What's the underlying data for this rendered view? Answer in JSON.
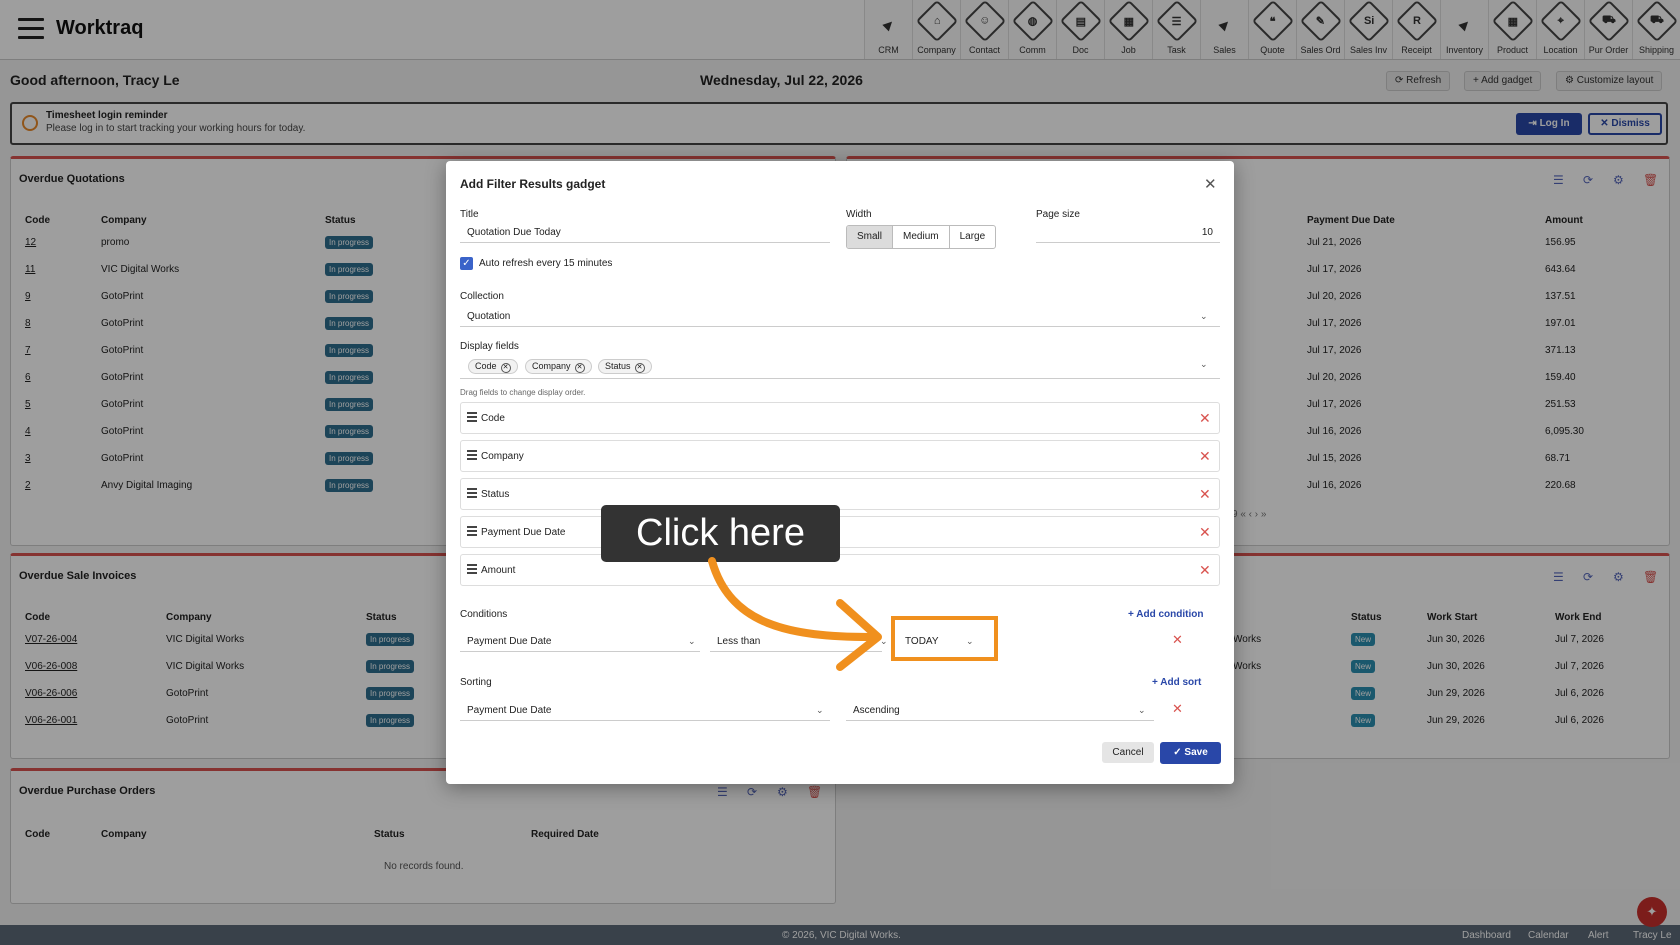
{
  "app": {
    "title": "Worktraq"
  },
  "modules": [
    {
      "label": "CRM",
      "icon": "chevron-right-icon",
      "glyph": "▶",
      "divider": true
    },
    {
      "label": "Company",
      "icon": "company-icon",
      "glyph": "⌂"
    },
    {
      "label": "Contact",
      "icon": "contact-icon",
      "glyph": "☺"
    },
    {
      "label": "Comm",
      "icon": "comm-icon",
      "glyph": "◍"
    },
    {
      "label": "Doc",
      "icon": "doc-icon",
      "glyph": "▤"
    },
    {
      "label": "Job",
      "icon": "job-icon",
      "glyph": "▦"
    },
    {
      "label": "Task",
      "icon": "task-icon",
      "glyph": "☰"
    },
    {
      "label": "Sales",
      "icon": "chevron-right-icon",
      "glyph": "▶",
      "divider": true
    },
    {
      "label": "Quote",
      "icon": "quote-icon",
      "glyph": "❝"
    },
    {
      "label": "Sales Ord",
      "icon": "sales-order-icon",
      "glyph": "✎"
    },
    {
      "label": "Sales Inv",
      "icon": "sales-invoice-icon",
      "glyph": "Si"
    },
    {
      "label": "Receipt",
      "icon": "receipt-icon",
      "glyph": "R"
    },
    {
      "label": "Inventory",
      "icon": "chevron-right-icon",
      "glyph": "▶",
      "divider": true
    },
    {
      "label": "Product",
      "icon": "product-icon",
      "glyph": "▦"
    },
    {
      "label": "Location",
      "icon": "location-icon",
      "glyph": "⌖"
    },
    {
      "label": "Pur Order",
      "icon": "purchase-order-icon",
      "glyph": "⛟"
    },
    {
      "label": "Shipping",
      "icon": "shipping-icon",
      "glyph": "⛟"
    }
  ],
  "header": {
    "greeting": "Good afternoon, Tracy Le",
    "date": "Wednesday, Jul 22, 2026",
    "refresh_label": "Refresh",
    "add_gadget_label": "Add gadget",
    "customize_label": "Customize layout"
  },
  "reminder": {
    "title": "Timesheet login reminder",
    "text": "Please log in to start tracking your working hours for today.",
    "login_label": "Log In",
    "dismiss_label": "Dismiss"
  },
  "overdue_quotations": {
    "title": "Overdue Quotations",
    "headers": [
      "Code",
      "Company",
      "Status"
    ],
    "rows": [
      {
        "code": "12",
        "company": "promo",
        "status": "In progress"
      },
      {
        "code": "11",
        "company": "VIC Digital Works",
        "status": "In progress"
      },
      {
        "code": "9",
        "company": "GotoPrint",
        "status": "In progress"
      },
      {
        "code": "8",
        "company": "GotoPrint",
        "status": "In progress"
      },
      {
        "code": "7",
        "company": "GotoPrint",
        "status": "In progress"
      },
      {
        "code": "6",
        "company": "GotoPrint",
        "status": "In progress"
      },
      {
        "code": "5",
        "company": "GotoPrint",
        "status": "In progress"
      },
      {
        "code": "4",
        "company": "GotoPrint",
        "status": "In progress"
      },
      {
        "code": "3",
        "company": "GotoPrint",
        "status": "In progress"
      },
      {
        "code": "2",
        "company": "Anvy Digital Imaging",
        "status": "In progress"
      }
    ]
  },
  "right_top": {
    "headers": [
      "Payment Due Date",
      "Amount"
    ],
    "rows": [
      {
        "date": "Jul 21, 2026",
        "amount": "156.95"
      },
      {
        "date": "Jul 17, 2026",
        "amount": "643.64"
      },
      {
        "date": "Jul 20, 2026",
        "amount": "137.51"
      },
      {
        "date": "Jul 17, 2026",
        "amount": "197.01"
      },
      {
        "date": "Jul 17, 2026",
        "amount": "371.13"
      },
      {
        "date": "Jul 20, 2026",
        "amount": "159.40"
      },
      {
        "date": "Jul 17, 2026",
        "amount": "251.53"
      },
      {
        "date": "Jul 16, 2026",
        "amount": "6,095.30"
      },
      {
        "date": "Jul 15, 2026",
        "amount": "68.71"
      },
      {
        "date": "Jul 16, 2026",
        "amount": "220.68"
      }
    ],
    "pager": "9   «   ‹   ›   »"
  },
  "overdue_invoices": {
    "title": "Overdue Sale Invoices",
    "headers": [
      "Code",
      "Company",
      "Status"
    ],
    "rows": [
      {
        "code": "V07-26-004",
        "company": "VIC Digital Works",
        "status": "In progress"
      },
      {
        "code": "V06-26-008",
        "company": "VIC Digital Works",
        "status": "In progress"
      },
      {
        "code": "V06-26-006",
        "company": "GotoPrint",
        "status": "In progress"
      },
      {
        "code": "V06-26-001",
        "company": "GotoPrint",
        "status": "In progress"
      }
    ]
  },
  "right_mid": {
    "headers": [
      "Status",
      "Work Start",
      "Work End"
    ],
    "rows": [
      {
        "company": "Works",
        "status": "New",
        "start": "Jun 30, 2026",
        "end": "Jul 7, 2026"
      },
      {
        "company": "Works",
        "status": "New",
        "start": "Jun 30, 2026",
        "end": "Jul 7, 2026"
      },
      {
        "company": "",
        "status": "New",
        "start": "Jun 29, 2026",
        "end": "Jul 6, 2026"
      },
      {
        "company": "",
        "status": "New",
        "start": "Jun 29, 2026",
        "end": "Jul 6, 2026"
      }
    ]
  },
  "overdue_purchase": {
    "title": "Overdue Purchase Orders",
    "headers": [
      "Code",
      "Company",
      "Status",
      "Required Date"
    ],
    "empty": "No records found."
  },
  "modal": {
    "title": "Add Filter Results gadget",
    "title_label": "Title",
    "title_value": "Quotation Due Today",
    "width_label": "Width",
    "width_options": [
      "Small",
      "Medium",
      "Large"
    ],
    "width_selected": "Small",
    "page_size_label": "Page size",
    "page_size_value": "10",
    "auto_refresh_label": "Auto refresh every 15 minutes",
    "collection_label": "Collection",
    "collection_value": "Quotation",
    "display_fields_label": "Display fields",
    "display_chips": [
      "Code",
      "Company",
      "Status"
    ],
    "drag_hint": "Drag fields to change display order.",
    "fields": [
      "Code",
      "Company",
      "Status",
      "Payment Due Date",
      "Amount"
    ],
    "conditions_label": "Conditions",
    "add_condition_label": "Add condition",
    "condition_field": "Payment Due Date",
    "condition_operator": "Less than",
    "condition_value": "TODAY",
    "sorting_label": "Sorting",
    "add_sort_label": "Add sort",
    "sort_field": "Payment Due Date",
    "sort_direction": "Ascending",
    "cancel_label": "Cancel",
    "save_label": "Save"
  },
  "callout": {
    "text": "Click here",
    "color": "#f0901e"
  },
  "footer": {
    "copyright": "© 2026, VIC Digital Works.",
    "links": [
      "Dashboard",
      "Calendar",
      "Alert",
      "Tracy Le"
    ]
  },
  "colors": {
    "accent": "#2947a8",
    "danger": "#d9534f",
    "highlight": "#f0901e",
    "badge": "#2e6e8e"
  }
}
